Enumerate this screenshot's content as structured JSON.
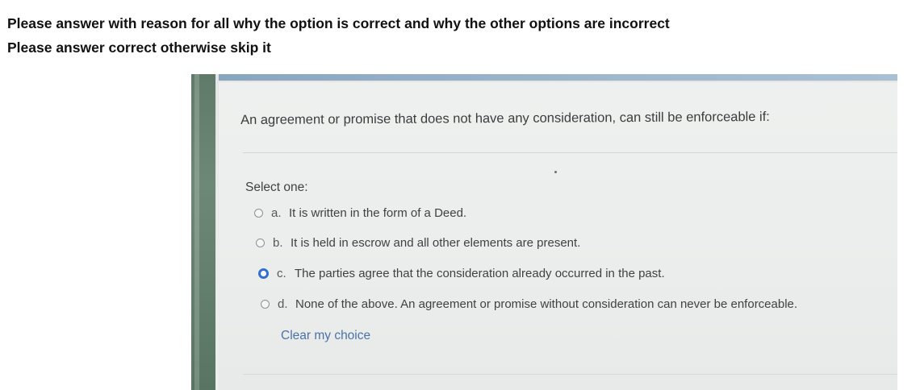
{
  "instructions": {
    "line1": "Please answer with reason for all why the option is correct and why the other options are incorrect",
    "line2": "Please answer correct otherwise skip it"
  },
  "quiz": {
    "question": "An agreement or promise that does not have any consideration, can still be enforceable if:",
    "select_label": "Select one:",
    "options": [
      {
        "letter": "a.",
        "text": "It is written in the form of a Deed.",
        "selected": false
      },
      {
        "letter": "b.",
        "text": "It is held in escrow and all other elements are present.",
        "selected": false
      },
      {
        "letter": "c.",
        "text": "The parties agree that the consideration already occurred in the past.",
        "selected": true
      },
      {
        "letter": "d.",
        "text": "None of the above. An agreement or promise without consideration can never be enforceable.",
        "selected": false
      }
    ],
    "clear_label": "Clear my choice"
  },
  "colors": {
    "selected_radio": "#2f6fd0",
    "link": "#4a72a8",
    "top_bar": "#9fb8cc",
    "left_strip": "#6d8877"
  }
}
